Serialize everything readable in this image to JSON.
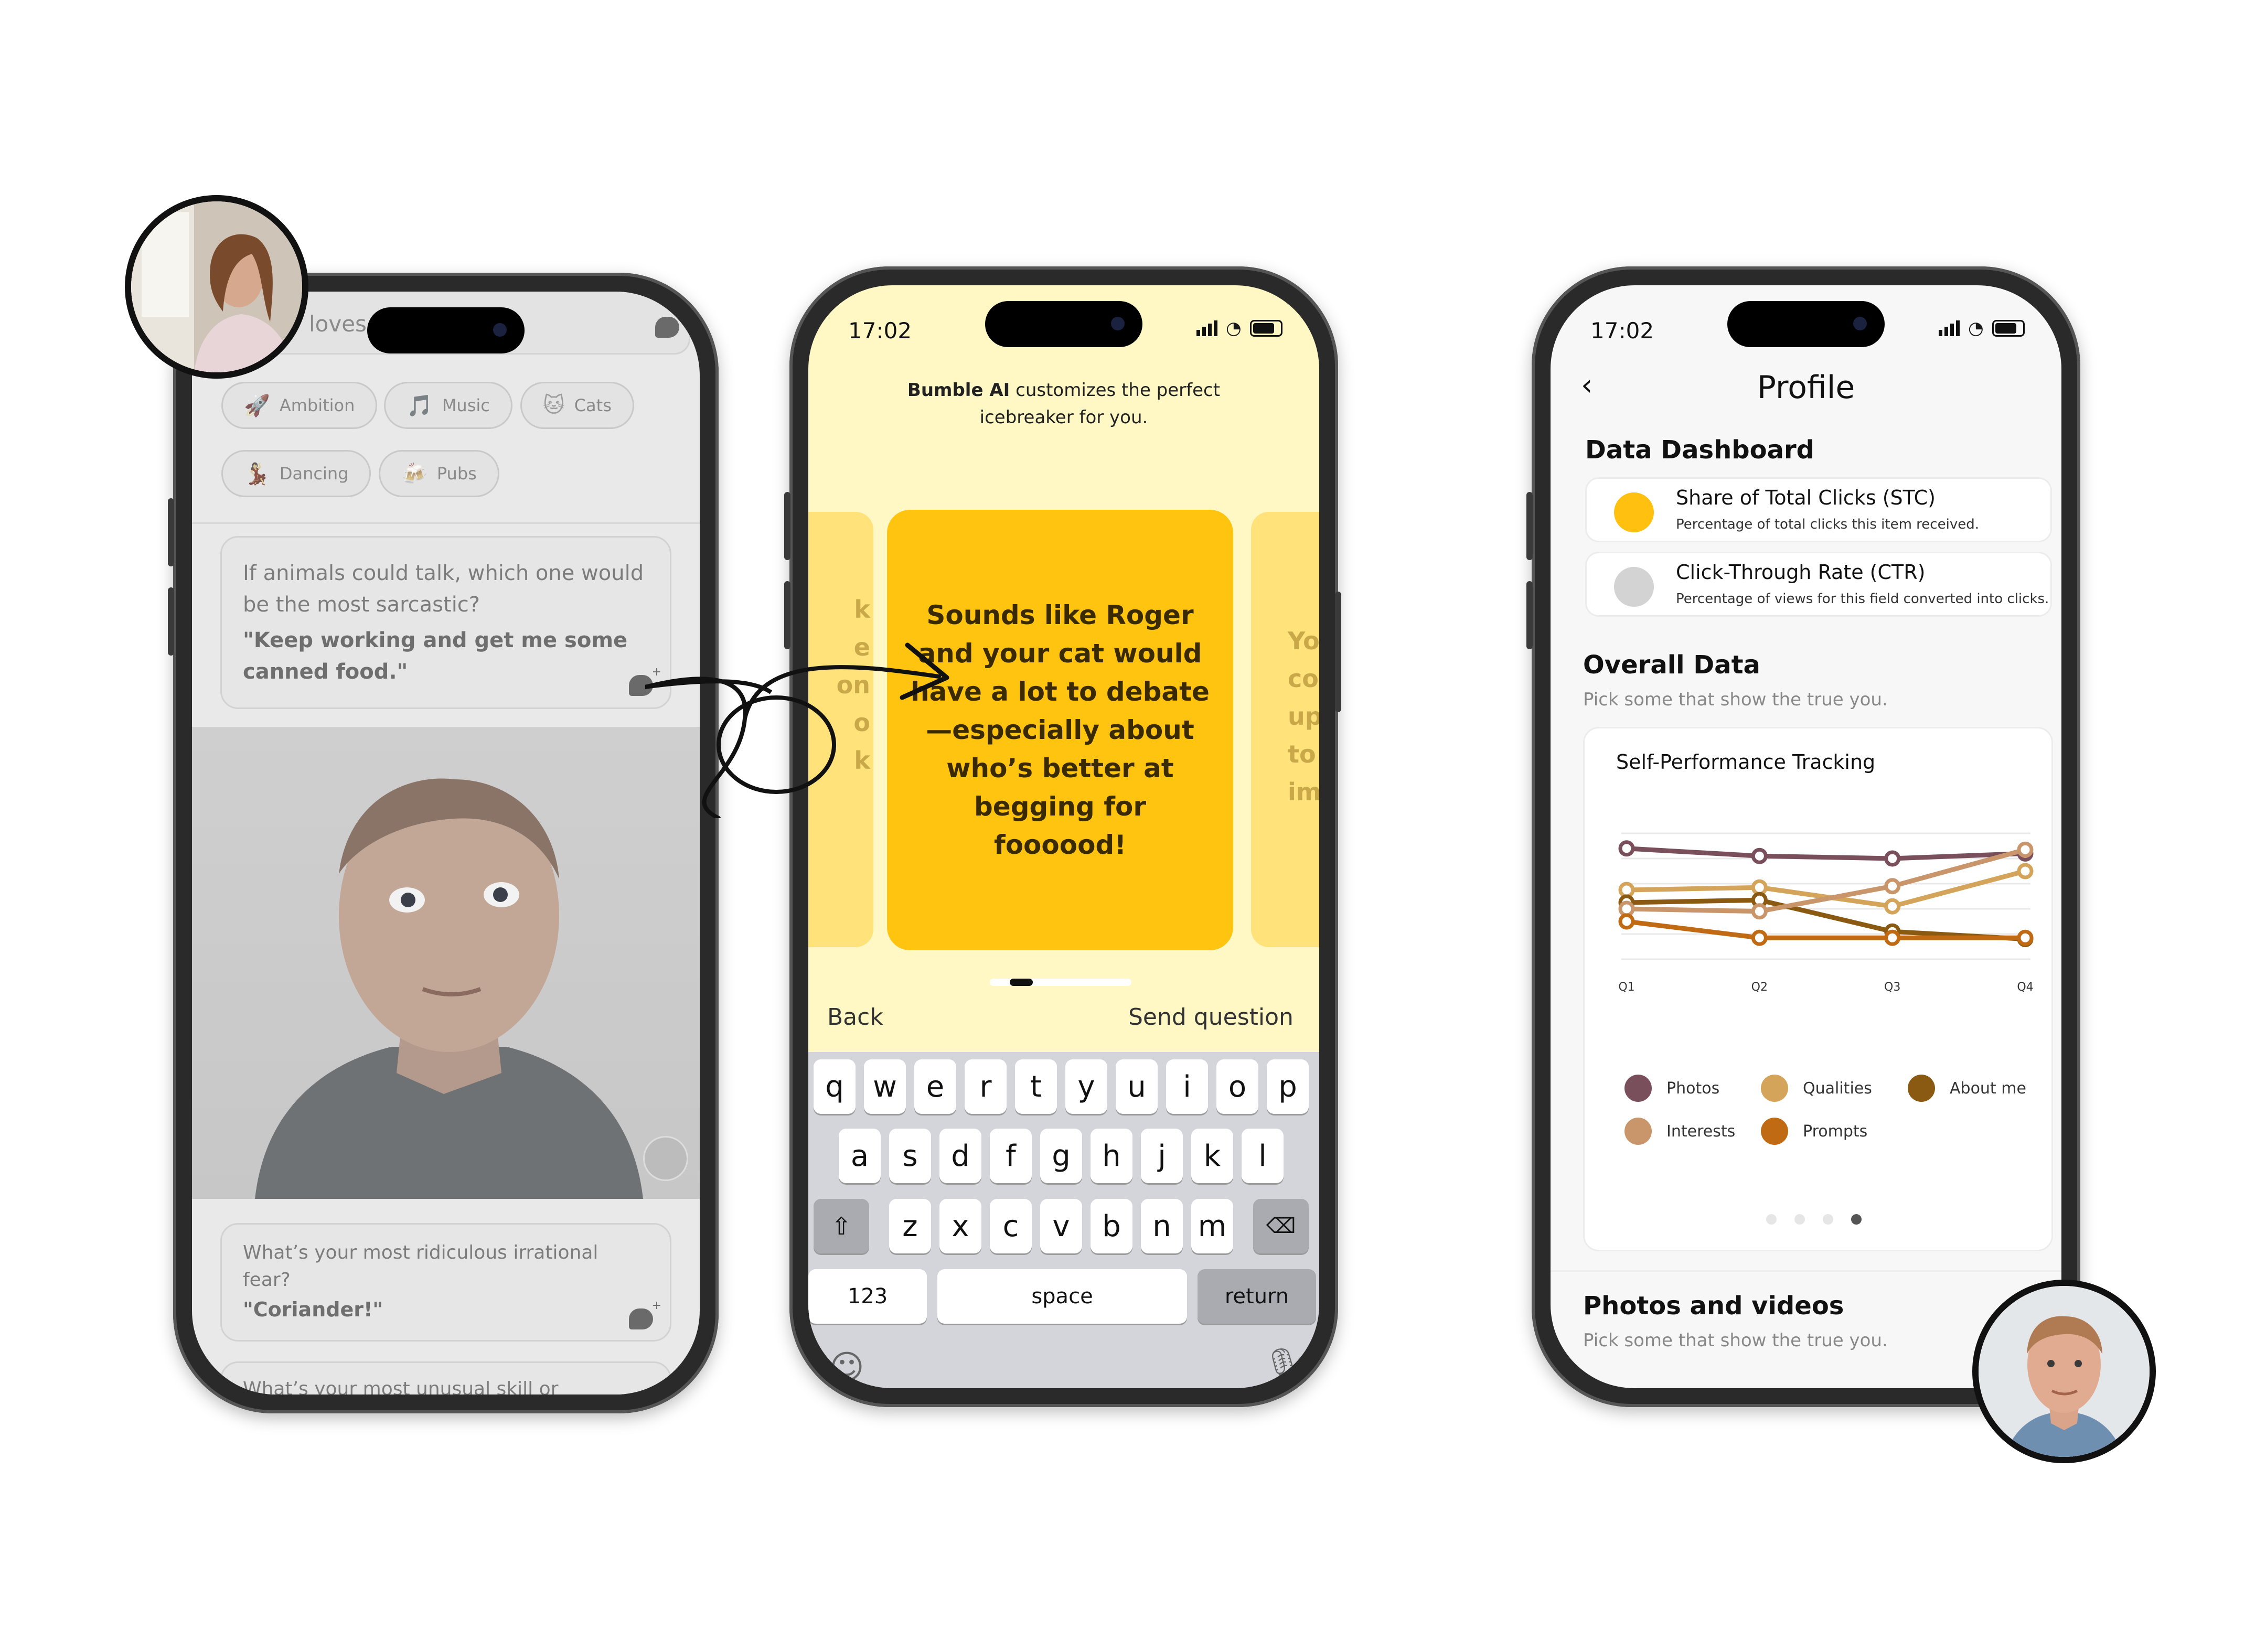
{
  "left_phone": {
    "title_partial": "loves Foodie",
    "chips": [
      {
        "icon": "🚀",
        "label": "Ambition"
      },
      {
        "icon": "🎵",
        "label": "Music"
      },
      {
        "icon": "🐱",
        "label": "Cats"
      },
      {
        "icon": "💃",
        "label": "Dancing"
      },
      {
        "icon": "🍻",
        "label": "Pubs"
      }
    ],
    "prompt_card_1": {
      "question": "If animals could talk, which one would be the most sarcastic?",
      "answer": "\"Keep working and get me some canned food.\""
    },
    "prompt_card_2": {
      "question": "What’s your most ridiculous irrational fear?",
      "answer": "\"Coriander!\""
    },
    "next_prompt_partial": "What’s your most unusual skill or"
  },
  "middle_phone": {
    "time": "17:02",
    "header_bold": "Bumble AI",
    "header_rest": " customizes the perfect",
    "header_line2": "icebreaker for you.",
    "left_card_fragments": [
      "k",
      "e",
      "on",
      "o",
      "k"
    ],
    "main_card_text": "Sounds like Roger and your cat would have a lot to debate—especially about who’s better at begging for foooood!",
    "right_card_fragments": [
      "Yo",
      "co",
      "up",
      "to",
      "im"
    ],
    "back_label": "Back",
    "send_label": "Send question",
    "keyboard": {
      "row1": [
        "q",
        "w",
        "e",
        "r",
        "t",
        "y",
        "u",
        "i",
        "o",
        "p"
      ],
      "row2": [
        "a",
        "s",
        "d",
        "f",
        "g",
        "h",
        "j",
        "k",
        "l"
      ],
      "row3": [
        "z",
        "x",
        "c",
        "v",
        "b",
        "n",
        "m"
      ],
      "numbers": "123",
      "space": "space",
      "return": "return"
    }
  },
  "right_phone": {
    "time": "17:02",
    "title": "Profile",
    "dashboard_heading": "Data Dashboard",
    "metrics": [
      {
        "title": "Share of Total Clicks (STC)",
        "subtitle": "Percentage of total clicks this item received.",
        "color": "#FFC00F"
      },
      {
        "title": "Click-Through Rate (CTR)",
        "subtitle": "Percentage of views for this field converted into clicks.",
        "color": "#D3D3D3"
      }
    ],
    "overall_heading": "Overall Data",
    "overall_sub": "Pick some that show the true you.",
    "photos_heading": "Photos and videos",
    "photos_sub": "Pick some that show the true you.",
    "page_dots": 4,
    "active_dot": 3
  },
  "chart_data": {
    "type": "line",
    "title": "Self-Performance Tracking",
    "categories": [
      "Q1",
      "Q2",
      "Q3",
      "Q4"
    ],
    "ylim": [
      0,
      100
    ],
    "grid": true,
    "legend_position": "bottom",
    "series": [
      {
        "name": "Photos",
        "color": "#7A4F5C",
        "values": [
          88,
          82,
          80,
          84
        ]
      },
      {
        "name": "Qualities",
        "color": "#D4A45A",
        "values": [
          55,
          57,
          42,
          70
        ]
      },
      {
        "name": "About me",
        "color": "#8A5A12",
        "values": [
          45,
          47,
          22,
          16
        ]
      },
      {
        "name": "Interests",
        "color": "#C9956A",
        "values": [
          40,
          38,
          58,
          87
        ]
      },
      {
        "name": "Prompts",
        "color": "#C06A14",
        "values": [
          30,
          17,
          17,
          17
        ]
      }
    ]
  }
}
